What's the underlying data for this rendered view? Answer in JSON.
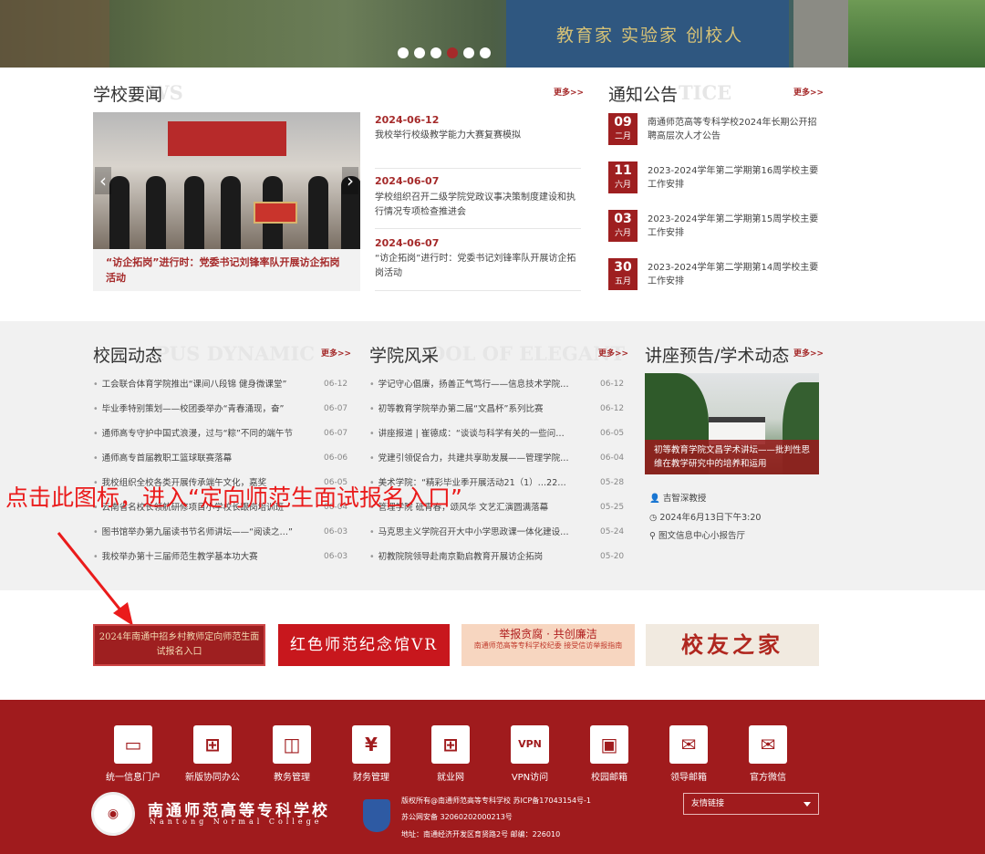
{
  "banner": {
    "sign_text": "教育家 实验家 创校人",
    "dots": 6,
    "active_dot": 4
  },
  "news": {
    "title": "学校要闻",
    "ghost": "WS",
    "more": "更多>>",
    "image_caption": "“访企拓岗”进行时：党委书记刘锋率队开展访企拓岗活动",
    "items": [
      {
        "date": "2024-06-12",
        "text": "我校举行校级教学能力大赛复赛模拟"
      },
      {
        "date": "2024-06-07",
        "text": "学校组织召开二级学院党政议事决策制度建设和执行情况专项检查推进会"
      },
      {
        "date": "2024-06-07",
        "text": "“访企拓岗”进行时：党委书记刘锋率队开展访企拓岗活动"
      }
    ]
  },
  "notice": {
    "title": "通知公告",
    "ghost": "TICE",
    "more": "更多>>",
    "items": [
      {
        "day": "09",
        "month": "二月",
        "text": "南通师范高等专科学校2024年长期公开招聘高层次人才公告"
      },
      {
        "day": "11",
        "month": "六月",
        "text": "2023-2024学年第二学期第16周学校主要工作安排"
      },
      {
        "day": "03",
        "month": "六月",
        "text": "2023-2024学年第二学期第15周学校主要工作安排"
      },
      {
        "day": "30",
        "month": "五月",
        "text": "2023-2024学年第二学期第14周学校主要工作安排"
      }
    ]
  },
  "campus": {
    "title": "校园动态",
    "ghost": "PUS DYNAMIC",
    "more": "更多>>",
    "items": [
      {
        "text": "工会联合体育学院推出“课间八段锦 健身微课堂”",
        "date": "06-12"
      },
      {
        "text": "毕业季特别策划——校团委举办“青春涌现，奋”",
        "date": "06-07"
      },
      {
        "text": "通师高专守护中国式浪漫，过与“粽”不同的端午节",
        "date": "06-07"
      },
      {
        "text": "通师高专首届教职工篮球联赛落幕",
        "date": "06-06"
      },
      {
        "text": "我校组织全校各类开展传承端午文化，嘉奖",
        "date": "06-05"
      },
      {
        "text": "云南省名校长领航研修项目小学校长跟岗培训班",
        "date": "06-04"
      },
      {
        "text": "图书馆举办第九届读书节名师讲坛——“阅读之…”",
        "date": "06-03"
      },
      {
        "text": "我校举办第十三届师范生教学基本功大赛",
        "date": "06-03"
      }
    ]
  },
  "college": {
    "title": "学院风采",
    "ghost": "OOL OF ELEGANT",
    "more": "更多>>",
    "items": [
      {
        "text": "学记守心倡廉，扬善正气笃行——信息技术学院…",
        "date": "06-12"
      },
      {
        "text": "初等教育学院举办第二届“文昌杯”系列比赛",
        "date": "06-12"
      },
      {
        "text": "讲座报道 | 崔德成：“谈谈与科学有关的一些问…",
        "date": "06-05"
      },
      {
        "text": "党建引领促合力，共建共享助发展——管理学院…",
        "date": "06-04"
      },
      {
        "text": "美术学院：“精彩毕业季开展活动21（1）…22…",
        "date": "05-28"
      },
      {
        "text": "管理学院 砥青春，颂风华 文艺汇演圆满落幕",
        "date": "05-25"
      },
      {
        "text": "马克思主义学院召开大中小学思政课一体化建设…",
        "date": "05-24"
      },
      {
        "text": "初教院院领导赴南京勤启教育开展访企拓岗",
        "date": "05-20"
      }
    ]
  },
  "lecture": {
    "title": "讲座预告/学术动态",
    "more": "更多>>",
    "caption": "初等教育学院文昌学术讲坛——批判性思维在教学研究中的培养和运用",
    "speaker": "吉智深教授",
    "time": "2024年6月13日下午3:20",
    "place": "图文信息中心小报告厅"
  },
  "annotation": "点击此图标，进入“定向师范生面试报名入口”",
  "links": {
    "l1": "2024年南通中招乡村教师定向师范生面试报名入口",
    "l2": "红色师范纪念馆VR",
    "l3_title": "举报贪腐 · 共创廉洁",
    "l3_sub": "南通师范高等专科学校纪委 接受信访举报指南",
    "l4": "校友之家"
  },
  "footer": {
    "icons": [
      {
        "label": "统一信息门户",
        "icon": "monitor-icon",
        "glyph": "▭"
      },
      {
        "label": "新版协同办公",
        "icon": "grid-icon",
        "glyph": "⊞"
      },
      {
        "label": "教务管理",
        "icon": "chart-icon",
        "glyph": "◫"
      },
      {
        "label": "财务管理",
        "icon": "yen-icon",
        "glyph": "¥"
      },
      {
        "label": "就业网",
        "icon": "apps-icon",
        "glyph": "⊞"
      },
      {
        "label": "VPN访问",
        "icon": "vpn-icon",
        "glyph": "VPN"
      },
      {
        "label": "校园邮箱",
        "icon": "briefcase-icon",
        "glyph": "▣"
      },
      {
        "label": "领导邮箱",
        "icon": "mail-icon",
        "glyph": "✉"
      },
      {
        "label": "官方微信",
        "icon": "wechat-mail-icon",
        "glyph": "✉"
      }
    ],
    "school_name": "南通师范高等专科学校",
    "school_name_en": "Nantong Normal College",
    "copyright": "版权所有@南通师范高等专科学校 苏ICP备17043154号-1",
    "police": "苏公网安备 32060202000213号",
    "address": "地址：南通经济开发区育贤路2号 邮编：226010",
    "friend_links": "友情链接"
  }
}
